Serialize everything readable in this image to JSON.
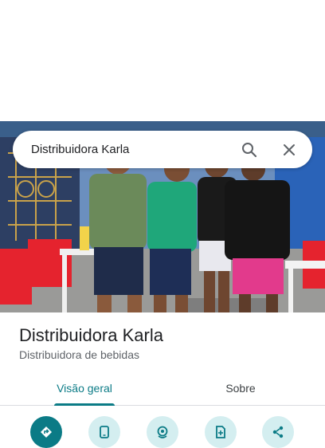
{
  "search": {
    "query": "Distribuidora Karla",
    "search_icon": "search-icon",
    "close_icon": "close-icon"
  },
  "place": {
    "name": "Distribuidora Karla",
    "category": "Distribuidora de bebidas"
  },
  "tabs": [
    {
      "label": "Visão geral",
      "active": true
    },
    {
      "label": "Sobre",
      "active": false
    }
  ],
  "actions": [
    {
      "icon": "directions-icon"
    },
    {
      "icon": "phone-icon"
    },
    {
      "icon": "location-icon"
    },
    {
      "icon": "save-icon"
    },
    {
      "icon": "share-icon"
    }
  ],
  "colors": {
    "accent": "#0b7b86",
    "action_bg": "#d4eef0",
    "text_primary": "#202124",
    "text_secondary": "#5f6368"
  }
}
